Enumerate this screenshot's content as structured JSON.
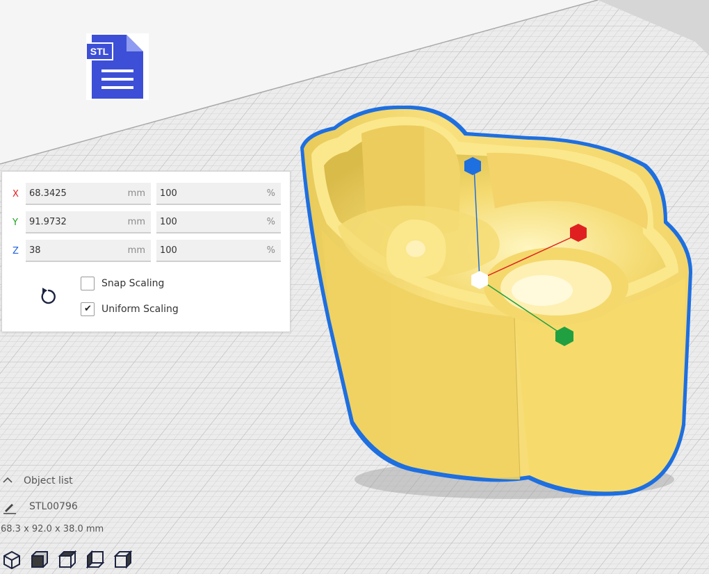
{
  "file_icon": {
    "label": "STL",
    "color": "#3d4fd6"
  },
  "scale_panel": {
    "rows": [
      {
        "axis": "X",
        "axis_color": "#e02020",
        "mm_value": "68.3425",
        "mm_unit": "mm",
        "pct_value": "100",
        "pct_unit": "%"
      },
      {
        "axis": "Y",
        "axis_color": "#20a020",
        "mm_value": "91.9732",
        "mm_unit": "mm",
        "pct_value": "100",
        "pct_unit": "%"
      },
      {
        "axis": "Z",
        "axis_color": "#2060e0",
        "mm_value": "38",
        "mm_unit": "mm",
        "pct_value": "100",
        "pct_unit": "%"
      }
    ],
    "snap_scaling": {
      "label": "Snap Scaling",
      "checked": false
    },
    "uniform_scaling": {
      "label": "Uniform Scaling",
      "checked": true
    },
    "reset_icon": "reset-icon"
  },
  "object_list": {
    "header_label": "Object list",
    "object_name": "STL00796",
    "dimensions": "68.3 x 92.0 x 38.0 mm"
  },
  "view_buttons": [
    "3d-view-icon",
    "front-view-icon",
    "top-view-icon",
    "left-view-icon",
    "right-view-icon"
  ],
  "colors": {
    "model_fill": "#f7e27a",
    "model_outline": "#1e6fe0",
    "gizmo_x": "#e02020",
    "gizmo_y": "#20a040",
    "gizmo_z": "#1e6fe0",
    "build_plate": "#e8e8e8",
    "grid_line": "#cccccc"
  }
}
